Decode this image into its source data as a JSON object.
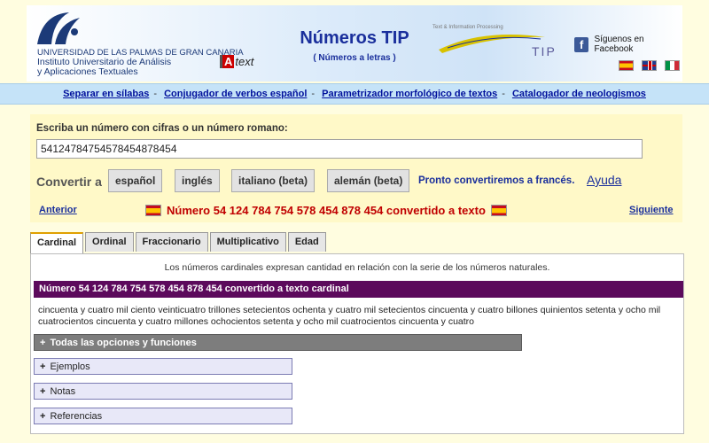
{
  "header": {
    "university_lines": [
      "UNIVERSIDAD DE LAS PALMAS DE GRAN CANARIA",
      "Instituto Universitario de Análisis",
      "y Aplicaciones Textuales"
    ],
    "atext_label": "text",
    "title": "Números TIP",
    "subtitle": "( Números a letras )",
    "tip_tagline": "Text & Information Processing",
    "tip_word": "TIP",
    "facebook_label": "Síguenos en Facebook"
  },
  "nav": {
    "links": [
      "Separar en sílabas",
      "Conjugador de verbos español",
      "Parametrizador morfológico de textos",
      "Catalogador de neologismos"
    ]
  },
  "form": {
    "label": "Escriba un número con cifras o un número romano:",
    "value": "541247847545784548784​54",
    "convert_label": "Convertir a",
    "buttons": [
      "español",
      "inglés",
      "italiano (beta)",
      "alemán (beta)"
    ],
    "soon_text": "Pronto convertiremos a francés.",
    "help_text": "Ayuda",
    "prev": "Anterior",
    "next": "Siguiente",
    "result_line": "Número 54 124 784 754 578 454 878 454 convertido a texto"
  },
  "tabs": [
    "Cardinal",
    "Ordinal",
    "Fraccionario",
    "Multiplicativo",
    "Edad"
  ],
  "content": {
    "description": "Los números cardinales expresan cantidad en relación con la serie de los números naturales.",
    "result_header": "Número 54 124 784 754 578 454 878 454 convertido a texto cardinal",
    "result_text": "cincuenta y cuatro mil ciento veinticuatro trillones setecientos ochenta y cuatro mil setecientos cincuenta y cuatro billones quinientos setenta y ocho mil cuatrocientos cincuenta y cuatro millones ochocientos setenta y ocho mil cuatrocientos cincuenta y cuatro",
    "accordion_all": "Todas las opciones y funciones",
    "accordions": [
      "Ejemplos",
      "Notas",
      "Referencias"
    ],
    "plus_symbol": "+"
  },
  "colors": {
    "title_blue": "#1a2f9c",
    "result_red": "#c00000",
    "header_purple": "#5c0a5c",
    "nav_bg": "#c5e3f8",
    "panel_bg": "#fff9c8"
  }
}
